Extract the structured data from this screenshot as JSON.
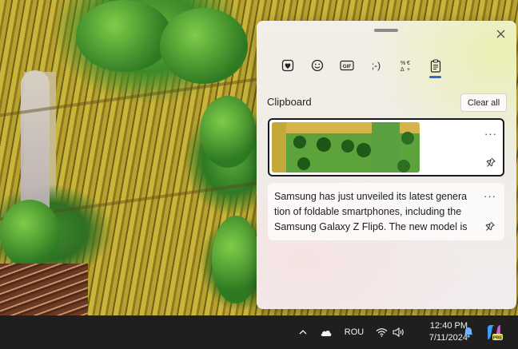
{
  "wallpaper": {
    "description_icon": "wallpaper-image"
  },
  "panel": {
    "tabs": [
      {
        "name": "emoji-favorites",
        "icon": "heart-sticker-icon"
      },
      {
        "name": "emoji",
        "icon": "smiley-icon"
      },
      {
        "name": "gif",
        "icon": "gif-icon",
        "label": "GIF"
      },
      {
        "name": "kaomoji",
        "icon": "kaomoji-icon",
        "label": ";-)"
      },
      {
        "name": "symbols",
        "icon": "symbols-icon"
      },
      {
        "name": "clipboard",
        "icon": "clipboard-icon",
        "active": true
      }
    ],
    "section_title": "Clipboard",
    "clear_all_label": "Clear all",
    "menu_glyph": "···",
    "items": [
      {
        "type": "image",
        "selected": true
      },
      {
        "type": "text",
        "text_lines": [
          "Samsung has just unveiled its latest genera",
          "tion of foldable smartphones, including the",
          "Samsung Galaxy Z Flip6. The new model is"
        ]
      }
    ],
    "accent_color": "#2a6ad3"
  },
  "taskbar": {
    "language": "ROU",
    "time": "12:40 PM",
    "date": "7/11/2024",
    "copilot_badge": "PRE",
    "icons": [
      "chevron-up-icon",
      "cloud-icon",
      "wifi-icon",
      "speaker-icon",
      "bell-icon",
      "copilot-icon"
    ]
  }
}
